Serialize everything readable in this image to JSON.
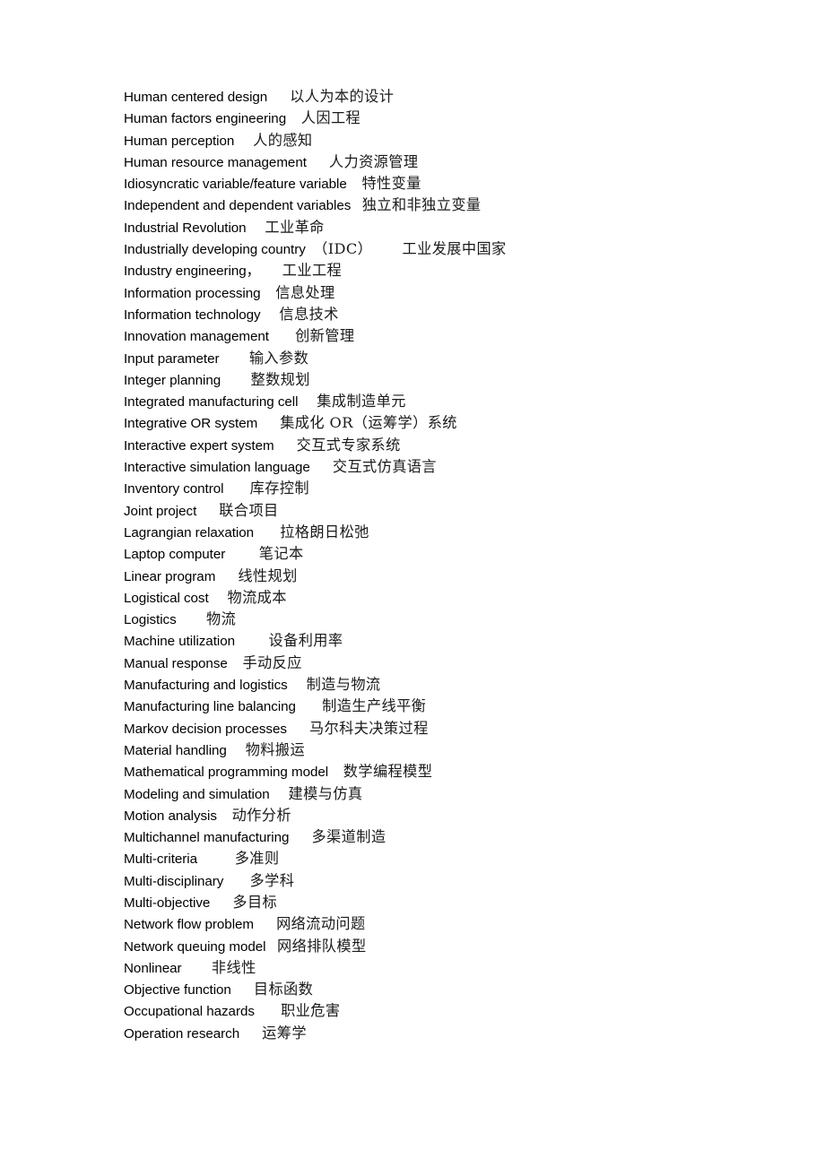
{
  "document": {
    "type": "bilingual-glossary",
    "language_pair": "English-Chinese",
    "background_color": "#ffffff",
    "text_color": "#000000"
  },
  "glossary": {
    "entries": [
      {
        "en": "Human centered design",
        "gap": "      ",
        "zh": "以人为本的设计"
      },
      {
        "en": "Human factors engineering",
        "gap": "    ",
        "zh": "人因工程"
      },
      {
        "en": "Human perception",
        "gap": "     ",
        "zh": "人的感知"
      },
      {
        "en": "Human resource management",
        "gap": "      ",
        "zh": "人力资源管理"
      },
      {
        "en": "Idiosyncratic variable/feature variable",
        "gap": "    ",
        "zh": "特性变量"
      },
      {
        "en": "Independent and dependent variables",
        "gap": "   ",
        "zh": "独立和非独立变量"
      },
      {
        "en": "Industrial Revolution",
        "gap": "     ",
        "zh": "工业革命"
      },
      {
        "en": "Industrially developing country",
        "gap": "  ",
        "zh": "（IDC）      工业发展中国家"
      },
      {
        "en": "Industry engineering，",
        "gap": "      ",
        "zh": "工业工程"
      },
      {
        "en": "Information processing",
        "gap": "    ",
        "zh": "信息处理"
      },
      {
        "en": "Information technology",
        "gap": "     ",
        "zh": "信息技术"
      },
      {
        "en": "Innovation management",
        "gap": "       ",
        "zh": "创新管理"
      },
      {
        "en": "Input parameter",
        "gap": "        ",
        "zh": "输入参数"
      },
      {
        "en": "Integer planning",
        "gap": "        ",
        "zh": "整数规划"
      },
      {
        "en": "Integrated manufacturing cell",
        "gap": "     ",
        "zh": "集成制造单元"
      },
      {
        "en": "Integrative OR system",
        "gap": "      ",
        "zh": "集成化 OR（运筹学）系统"
      },
      {
        "en": "Interactive expert system",
        "gap": "      ",
        "zh": "交互式专家系统"
      },
      {
        "en": "Interactive simulation language",
        "gap": "      ",
        "zh": "交互式仿真语言"
      },
      {
        "en": "Inventory control",
        "gap": "       ",
        "zh": "库存控制"
      },
      {
        "en": "Joint project",
        "gap": "      ",
        "zh": "联合项目"
      },
      {
        "en": "Lagrangian relaxation",
        "gap": "       ",
        "zh": "拉格朗日松弛"
      },
      {
        "en": "Laptop computer",
        "gap": "         ",
        "zh": "笔记本"
      },
      {
        "en": "Linear program",
        "gap": "      ",
        "zh": "线性规划"
      },
      {
        "en": "Logistical cost",
        "gap": "     ",
        "zh": "物流成本"
      },
      {
        "en": "Logistics",
        "gap": "        ",
        "zh": "物流"
      },
      {
        "en": "Machine utilization",
        "gap": "         ",
        "zh": "设备利用率"
      },
      {
        "en": "Manual response",
        "gap": "    ",
        "zh": "手动反应"
      },
      {
        "en": "Manufacturing and logistics",
        "gap": "     ",
        "zh": "制造与物流"
      },
      {
        "en": "Manufacturing line balancing",
        "gap": "       ",
        "zh": "制造生产线平衡"
      },
      {
        "en": "Markov decision processes",
        "gap": "      ",
        "zh": "马尔科夫决策过程"
      },
      {
        "en": "Material handling",
        "gap": "     ",
        "zh": "物料搬运"
      },
      {
        "en": "Mathematical programming model",
        "gap": "    ",
        "zh": "数学编程模型"
      },
      {
        "en": "Modeling and simulation",
        "gap": "     ",
        "zh": "建模与仿真"
      },
      {
        "en": "Motion analysis",
        "gap": "    ",
        "zh": "动作分析"
      },
      {
        "en": "Multichannel manufacturing",
        "gap": "      ",
        "zh": "多渠道制造"
      },
      {
        "en": "Multi-criteria",
        "gap": "          ",
        "zh": "多准则"
      },
      {
        "en": "Multi-disciplinary",
        "gap": "       ",
        "zh": "多学科"
      },
      {
        "en": "Multi-objective",
        "gap": "      ",
        "zh": "多目标"
      },
      {
        "en": "Network flow problem",
        "gap": "      ",
        "zh": "网络流动问题"
      },
      {
        "en": "Network queuing model",
        "gap": "   ",
        "zh": "网络排队模型"
      },
      {
        "en": "Nonlinear",
        "gap": "        ",
        "zh": "非线性"
      },
      {
        "en": "Objective function",
        "gap": "      ",
        "zh": "目标函数"
      },
      {
        "en": "Occupational hazards",
        "gap": "       ",
        "zh": "职业危害"
      },
      {
        "en": "Operation research",
        "gap": "      ",
        "zh": "运筹学"
      }
    ]
  }
}
